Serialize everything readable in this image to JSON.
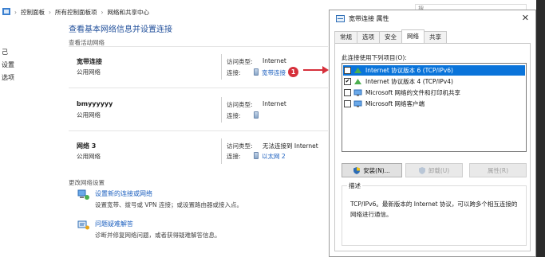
{
  "control_panel": {
    "address": [
      "控制面板",
      "所有控制面板项",
      "网络和共享中心"
    ],
    "left_nav": [
      "己",
      "设置",
      "选项"
    ],
    "title": "查看基本网络信息并设置连接",
    "active_networks_label": "查看活动网络",
    "networks": [
      {
        "name": "宽带连接",
        "type": "公用网络",
        "access_label": "访问类型:",
        "access_value": "Internet",
        "conn_label": "连接:",
        "conn_value": "宽带连接"
      },
      {
        "name": "bmyyyyyy",
        "type": "公用网络",
        "access_label": "访问类型:",
        "access_value": "Internet",
        "conn_label": "连接:",
        "conn_value": ""
      },
      {
        "name": "网络 3",
        "type": "公用网络",
        "access_label": "访问类型:",
        "access_value": "无法连接到 Internet",
        "conn_label": "连接:",
        "conn_value": "以太网 2"
      }
    ],
    "change_settings_label": "更改网络设置",
    "tasks": [
      {
        "link": "设置新的连接或网络",
        "desc": "设置宽带、拨号或 VPN 连接；或设置路由器或接入点。",
        "icon": "new-connection-icon"
      },
      {
        "link": "问题疑难解答",
        "desc": "诊断并修复网络问题，或者获得疑难解答信息。",
        "icon": "troubleshoot-icon"
      }
    ],
    "badge": "1"
  },
  "search_placeholder": "搜",
  "dialog": {
    "title": "宽带连接 属性",
    "close": "✕",
    "tabs": [
      {
        "label": "常规",
        "active": false
      },
      {
        "label": "选项",
        "active": false
      },
      {
        "label": "安全",
        "active": false
      },
      {
        "label": "网络",
        "active": true
      },
      {
        "label": "共享",
        "active": false
      }
    ],
    "items_label": "此连接使用下列项目(O):",
    "items": [
      {
        "label": "Internet 协议版本 6 (TCP/IPv6)",
        "checked": false,
        "selected": true
      },
      {
        "label": "Internet 协议版本 4 (TCP/IPv4)",
        "checked": true,
        "selected": false
      },
      {
        "label": "Microsoft 网络的文件和打印机共享",
        "checked": false,
        "selected": false
      },
      {
        "label": "Microsoft 网络客户端",
        "checked": false,
        "selected": false
      }
    ],
    "install_label": "安装(N)...",
    "uninstall_label": "卸载(U)",
    "properties_label": "属性(R)",
    "description_title": "描述",
    "description_text": "TCP/IPv6。最新版本的 Internet 协议，可以跨多个相互连接的网络进行通信。",
    "check_mark": "✔"
  },
  "colors": {
    "accent": "#0a74da",
    "link": "#1b5fbf",
    "badge": "#d6303b"
  }
}
